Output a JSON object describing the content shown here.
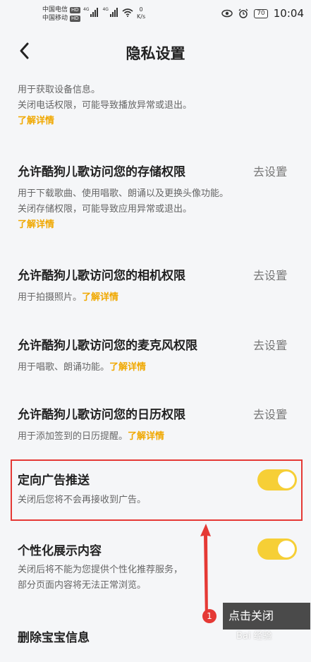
{
  "status_bar": {
    "carrier1": "中国电信",
    "carrier2": "中国移动",
    "hd": "HD",
    "signal_type": "4G",
    "speed_value": "0",
    "speed_unit": "K/s",
    "battery": "70",
    "time": "10:04"
  },
  "header": {
    "title": "隐私设置"
  },
  "top_partial": {
    "desc_line1": "用于获取设备信息。",
    "desc_line2": "关闭电话权限，可能导致播放异常或退出。",
    "link": "了解详情"
  },
  "permissions": [
    {
      "title": "允许酷狗儿歌访问您的存储权限",
      "action": "去设置",
      "desc_line1": "用于下载歌曲、使用唱歌、朗诵以及更换头像功能。",
      "desc_line2": "关闭存储权限，可能导致应用异常或退出。",
      "link": "了解详情"
    },
    {
      "title": "允许酷狗儿歌访问您的相机权限",
      "action": "去设置",
      "desc": "用于拍摄照片。",
      "link": "了解详情"
    },
    {
      "title": "允许酷狗儿歌访问您的麦克风权限",
      "action": "去设置",
      "desc": "用于唱歌、朗诵功能。",
      "link": "了解详情"
    },
    {
      "title": "允许酷狗儿歌访问您的日历权限",
      "action": "去设置",
      "desc": "用于添加签到的日历提醒。",
      "link": "了解详情"
    }
  ],
  "toggles": [
    {
      "title": "定向广告推送",
      "desc": "关闭后您将不会再接收到广告。",
      "on": true
    },
    {
      "title": "个性化展示内容",
      "desc_line1": "关闭后将不能为您提供个性化推荐服务，",
      "desc_line2": "部分页面内容将无法正常浏览。",
      "on": true
    }
  ],
  "delete_item": {
    "title": "删除宝宝信息"
  },
  "annotation": {
    "number": "1",
    "label": "点击关闭"
  },
  "watermark": "Bai 经验",
  "colors": {
    "accent": "#f6cf36",
    "link": "#f0a800",
    "highlight": "#e53935"
  }
}
